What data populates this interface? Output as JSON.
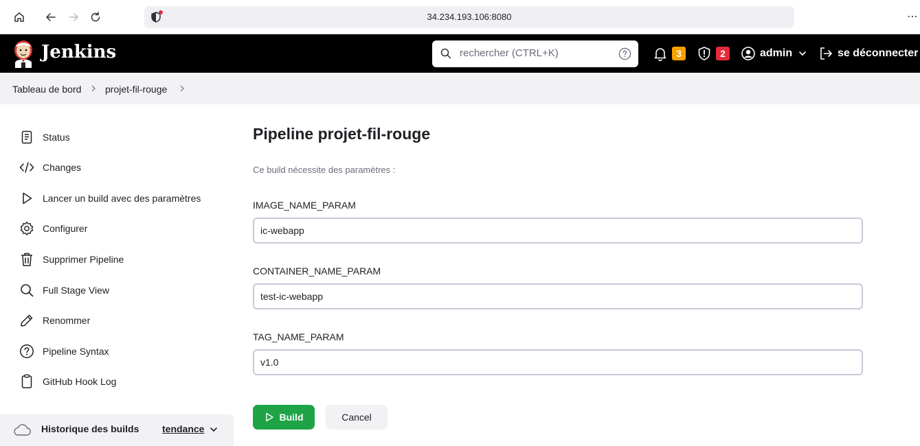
{
  "browser": {
    "url": "34.234.193.106:8080",
    "more_label": "⋯"
  },
  "header": {
    "title": "Jenkins",
    "search_placeholder": "rechercher (CTRL+K)",
    "notifications_count": "3",
    "notifications_color": "#f7a000",
    "security_count": "2",
    "security_color": "#e42a3b",
    "user": "admin",
    "logout": "se déconnecter"
  },
  "breadcrumb": {
    "items": [
      "Tableau de bord",
      "projet-fil-rouge"
    ]
  },
  "sidebar": {
    "items": [
      {
        "label": "Status",
        "icon": "document-icon"
      },
      {
        "label": "Changes",
        "icon": "code-icon"
      },
      {
        "label": "Lancer un build avec des paramètres",
        "icon": "play-icon"
      },
      {
        "label": "Configurer",
        "icon": "gear-icon"
      },
      {
        "label": "Supprimer Pipeline",
        "icon": "trash-icon"
      },
      {
        "label": "Full Stage View",
        "icon": "search-icon"
      },
      {
        "label": "Renommer",
        "icon": "pencil-icon"
      },
      {
        "label": "Pipeline Syntax",
        "icon": "help-icon"
      },
      {
        "label": "GitHub Hook Log",
        "icon": "clipboard-icon"
      }
    ],
    "history": {
      "label": "Historique des builds",
      "trend": "tendance"
    }
  },
  "main": {
    "title": "Pipeline projet-fil-rouge",
    "subtitle": "Ce build nécessite des paramètres :",
    "params": [
      {
        "name": "IMAGE_NAME_PARAM",
        "value": "ic-webapp"
      },
      {
        "name": "CONTAINER_NAME_PARAM",
        "value": "test-ic-webapp"
      },
      {
        "name": "TAG_NAME_PARAM",
        "value": "v1.0"
      }
    ],
    "build_label": "Build",
    "cancel_label": "Cancel"
  },
  "colors": {
    "build_green": "#1ea446",
    "header_black": "#000000"
  }
}
